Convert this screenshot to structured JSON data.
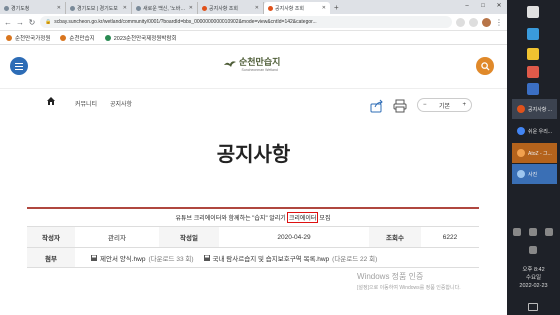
{
  "browser": {
    "tabs": [
      {
        "title": "경기도청",
        "active": false
      },
      {
        "title": "경기도보 | 경기도보",
        "active": false
      },
      {
        "title": "새로운 백신, '노바백스'",
        "active": false
      },
      {
        "title": "공지사항 조회",
        "active": false
      },
      {
        "title": "공지사항 조회",
        "active": true
      }
    ],
    "new_tab": "+",
    "win_minimize": "–",
    "win_maximize": "□",
    "win_close": "✕",
    "url": "scbay.suncheon.go.kr/wetland/community/0001/?boardId=bbs_0000000000010902&mode=view&cntId=142&categor...",
    "bookmarks": [
      {
        "label": "순천만국가정원"
      },
      {
        "label": "순천만습지"
      },
      {
        "label": "2023순천만국제정원박람회"
      }
    ]
  },
  "site": {
    "logo_ko": "순천만습지",
    "logo_en": "Suncheonman Wetland",
    "breadcrumb": [
      "커뮤니티",
      "공지사항"
    ],
    "zoom_minus": "−",
    "zoom_label": "기본",
    "zoom_plus": "+",
    "page_title": "공지사항"
  },
  "post": {
    "subject_before": "유튜브 크리에이터와 함께하는 \"습지\" 알리기 ",
    "subject_highlight": "크리에이터",
    "subject_after": " 모집",
    "labels": {
      "author": "작성자",
      "date": "작성일",
      "views": "조회수",
      "files": "첨부"
    },
    "author": "관리자",
    "date": "2020-04-29",
    "views": "6222",
    "files": [
      {
        "name": "제안서 양식.hwp",
        "downloads": "(다운로드 33 회)"
      },
      {
        "name": "국내 람사르습지 및 습지보호구역 목록.hwp",
        "downloads": "(다운로드 22 회)"
      }
    ]
  },
  "watermark": {
    "line1": "Windows 정품 인증",
    "line2": "[설정]으로 이동하여 Windows를 정품 인증합니다."
  },
  "taskbar": {
    "apps": [
      {
        "label": "공지사항 ...",
        "color": "#e0521b",
        "state": "active"
      },
      {
        "label": "쉬운 우리...",
        "color": "#4285f4",
        "state": "normal"
      },
      {
        "label": "AtoZ - 그...",
        "color": "#f28a1e",
        "state": "orange"
      },
      {
        "label": "사진",
        "color": "#5a9be0",
        "state": "selected"
      }
    ],
    "clock_period": "오후 8:42",
    "clock_day": "수요일",
    "clock_date": "2022-02-23"
  },
  "colors": {
    "menu_blue": "#2d6cb6",
    "search_orange": "#e0892a",
    "board_top_border": "#b0473f",
    "highlight_box": "#dd1111"
  }
}
